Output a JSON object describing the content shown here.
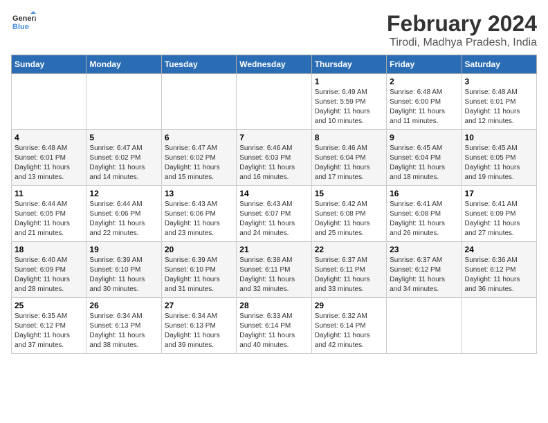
{
  "logo": {
    "line1": "General",
    "line2": "Blue"
  },
  "title": "February 2024",
  "subtitle": "Tirodi, Madhya Pradesh, India",
  "weekdays": [
    "Sunday",
    "Monday",
    "Tuesday",
    "Wednesday",
    "Thursday",
    "Friday",
    "Saturday"
  ],
  "weeks": [
    [
      {
        "day": "",
        "info": ""
      },
      {
        "day": "",
        "info": ""
      },
      {
        "day": "",
        "info": ""
      },
      {
        "day": "",
        "info": ""
      },
      {
        "day": "1",
        "info": "Sunrise: 6:49 AM\nSunset: 5:59 PM\nDaylight: 11 hours\nand 10 minutes."
      },
      {
        "day": "2",
        "info": "Sunrise: 6:48 AM\nSunset: 6:00 PM\nDaylight: 11 hours\nand 11 minutes."
      },
      {
        "day": "3",
        "info": "Sunrise: 6:48 AM\nSunset: 6:01 PM\nDaylight: 11 hours\nand 12 minutes."
      }
    ],
    [
      {
        "day": "4",
        "info": "Sunrise: 6:48 AM\nSunset: 6:01 PM\nDaylight: 11 hours\nand 13 minutes."
      },
      {
        "day": "5",
        "info": "Sunrise: 6:47 AM\nSunset: 6:02 PM\nDaylight: 11 hours\nand 14 minutes."
      },
      {
        "day": "6",
        "info": "Sunrise: 6:47 AM\nSunset: 6:02 PM\nDaylight: 11 hours\nand 15 minutes."
      },
      {
        "day": "7",
        "info": "Sunrise: 6:46 AM\nSunset: 6:03 PM\nDaylight: 11 hours\nand 16 minutes."
      },
      {
        "day": "8",
        "info": "Sunrise: 6:46 AM\nSunset: 6:04 PM\nDaylight: 11 hours\nand 17 minutes."
      },
      {
        "day": "9",
        "info": "Sunrise: 6:45 AM\nSunset: 6:04 PM\nDaylight: 11 hours\nand 18 minutes."
      },
      {
        "day": "10",
        "info": "Sunrise: 6:45 AM\nSunset: 6:05 PM\nDaylight: 11 hours\nand 19 minutes."
      }
    ],
    [
      {
        "day": "11",
        "info": "Sunrise: 6:44 AM\nSunset: 6:05 PM\nDaylight: 11 hours\nand 21 minutes."
      },
      {
        "day": "12",
        "info": "Sunrise: 6:44 AM\nSunset: 6:06 PM\nDaylight: 11 hours\nand 22 minutes."
      },
      {
        "day": "13",
        "info": "Sunrise: 6:43 AM\nSunset: 6:06 PM\nDaylight: 11 hours\nand 23 minutes."
      },
      {
        "day": "14",
        "info": "Sunrise: 6:43 AM\nSunset: 6:07 PM\nDaylight: 11 hours\nand 24 minutes."
      },
      {
        "day": "15",
        "info": "Sunrise: 6:42 AM\nSunset: 6:08 PM\nDaylight: 11 hours\nand 25 minutes."
      },
      {
        "day": "16",
        "info": "Sunrise: 6:41 AM\nSunset: 6:08 PM\nDaylight: 11 hours\nand 26 minutes."
      },
      {
        "day": "17",
        "info": "Sunrise: 6:41 AM\nSunset: 6:09 PM\nDaylight: 11 hours\nand 27 minutes."
      }
    ],
    [
      {
        "day": "18",
        "info": "Sunrise: 6:40 AM\nSunset: 6:09 PM\nDaylight: 11 hours\nand 28 minutes."
      },
      {
        "day": "19",
        "info": "Sunrise: 6:39 AM\nSunset: 6:10 PM\nDaylight: 11 hours\nand 30 minutes."
      },
      {
        "day": "20",
        "info": "Sunrise: 6:39 AM\nSunset: 6:10 PM\nDaylight: 11 hours\nand 31 minutes."
      },
      {
        "day": "21",
        "info": "Sunrise: 6:38 AM\nSunset: 6:11 PM\nDaylight: 11 hours\nand 32 minutes."
      },
      {
        "day": "22",
        "info": "Sunrise: 6:37 AM\nSunset: 6:11 PM\nDaylight: 11 hours\nand 33 minutes."
      },
      {
        "day": "23",
        "info": "Sunrise: 6:37 AM\nSunset: 6:12 PM\nDaylight: 11 hours\nand 34 minutes."
      },
      {
        "day": "24",
        "info": "Sunrise: 6:36 AM\nSunset: 6:12 PM\nDaylight: 11 hours\nand 36 minutes."
      }
    ],
    [
      {
        "day": "25",
        "info": "Sunrise: 6:35 AM\nSunset: 6:12 PM\nDaylight: 11 hours\nand 37 minutes."
      },
      {
        "day": "26",
        "info": "Sunrise: 6:34 AM\nSunset: 6:13 PM\nDaylight: 11 hours\nand 38 minutes."
      },
      {
        "day": "27",
        "info": "Sunrise: 6:34 AM\nSunset: 6:13 PM\nDaylight: 11 hours\nand 39 minutes."
      },
      {
        "day": "28",
        "info": "Sunrise: 6:33 AM\nSunset: 6:14 PM\nDaylight: 11 hours\nand 40 minutes."
      },
      {
        "day": "29",
        "info": "Sunrise: 6:32 AM\nSunset: 6:14 PM\nDaylight: 11 hours\nand 42 minutes."
      },
      {
        "day": "",
        "info": ""
      },
      {
        "day": "",
        "info": ""
      }
    ]
  ]
}
